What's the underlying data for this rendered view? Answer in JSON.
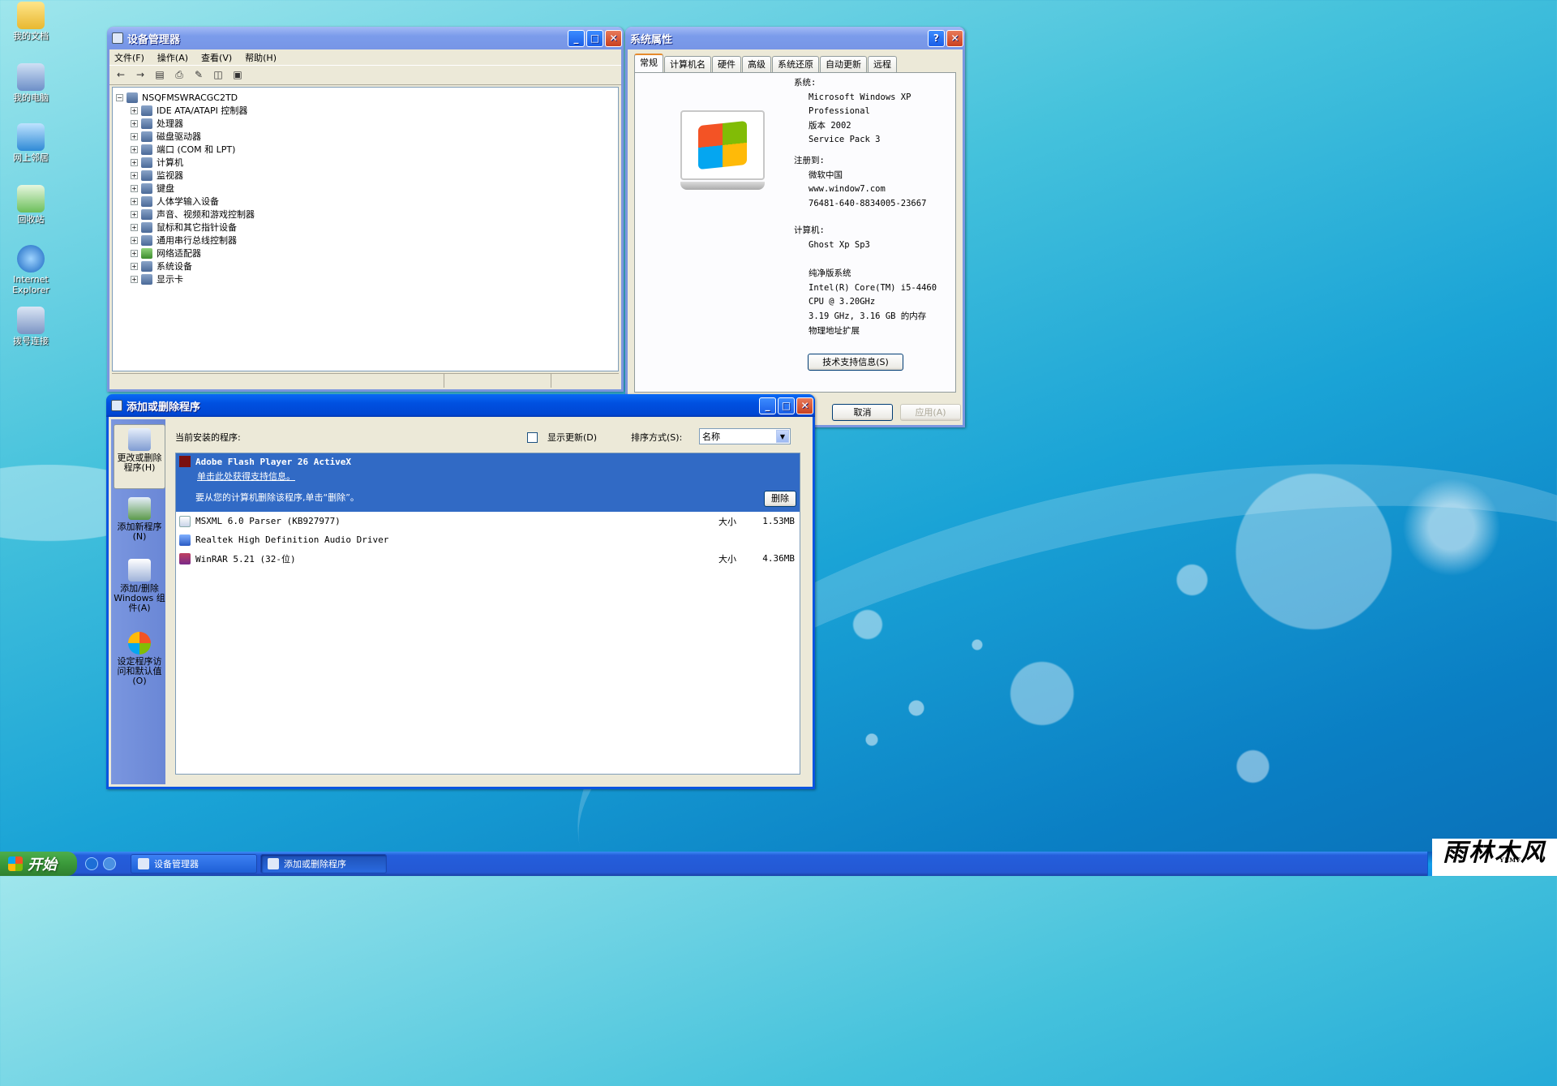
{
  "desktop": {
    "icons": [
      {
        "label": "我的文档"
      },
      {
        "label": "我的电脑"
      },
      {
        "label": "网上邻居"
      },
      {
        "label": "回收站"
      },
      {
        "label": "Internet Explorer"
      },
      {
        "label": "拨号连接"
      }
    ]
  },
  "device_manager": {
    "title": "设备管理器",
    "menu": [
      "文件(F)",
      "操作(A)",
      "查看(V)",
      "帮助(H)"
    ],
    "root": "NSQFMSWRACGC2TD",
    "nodes": [
      "IDE ATA/ATAPI 控制器",
      "处理器",
      "磁盘驱动器",
      "端口 (COM 和 LPT)",
      "计算机",
      "监视器",
      "键盘",
      "人体学输入设备",
      "声音、视频和游戏控制器",
      "鼠标和其它指针设备",
      "通用串行总线控制器",
      "网络适配器",
      "系统设备",
      "显示卡"
    ]
  },
  "system_properties": {
    "title": "系统属性",
    "tabs": [
      "常规",
      "计算机名",
      "硬件",
      "高级",
      "系统还原",
      "自动更新",
      "远程"
    ],
    "system_label": "系统:",
    "system_lines": [
      "Microsoft Windows XP",
      "Professional",
      "版本 2002",
      "Service Pack 3"
    ],
    "registered_label": "注册到:",
    "registered_lines": [
      "微软中国",
      "www.window7.com",
      "76481-640-8834005-23667"
    ],
    "computer_label": "计算机:",
    "computer_lines": [
      "Ghost Xp Sp3",
      "",
      "纯净版系统",
      "Intel(R) Core(TM) i5-4460",
      "CPU @ 3.20GHz",
      "3.19 GHz, 3.16 GB 的内存",
      "物理地址扩展"
    ],
    "support_button": "技术支持信息(S)",
    "cancel_button": "取消",
    "apply_button": "应用(A)"
  },
  "add_remove": {
    "title": "添加或删除程序",
    "sidebar": [
      {
        "label": "更改或删除程序(H)"
      },
      {
        "label": "添加新程序(N)"
      },
      {
        "label": "添加/删除 Windows 组件(A)"
      },
      {
        "label": "设定程序访问和默认值(O)"
      }
    ],
    "current_label": "当前安装的程序:",
    "show_updates": "显示更新(D)",
    "sort_label": "排序方式(S):",
    "sort_value": "名称",
    "selected_program": {
      "name": "Adobe Flash Player 26 ActiveX",
      "support_link": "单击此处获得支持信息。",
      "remove_hint": "要从您的计算机删除该程序,单击“删除”。",
      "remove_button": "删除"
    },
    "programs": [
      {
        "name": "MSXML 6.0 Parser (KB927977)",
        "size_label": "大小",
        "size": "1.53MB"
      },
      {
        "name": "Realtek High Definition Audio Driver",
        "size_label": "",
        "size": ""
      },
      {
        "name": "WinRAR 5.21 (32-位)",
        "size_label": "大小",
        "size": "4.36MB"
      }
    ]
  },
  "taskbar": {
    "start_label": "开始",
    "tasks": [
      "设备管理器",
      "添加或删除程序"
    ]
  },
  "watermark": "雨林木风 YLMF"
}
